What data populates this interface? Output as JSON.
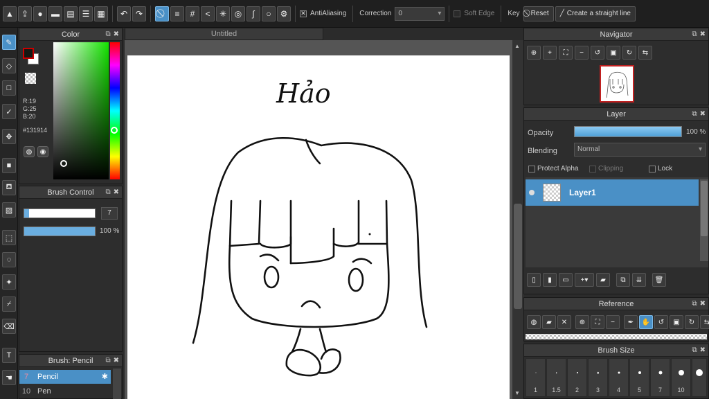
{
  "toolbar": {
    "antialiasing_label": "AntiAliasing",
    "correction_label": "Correction",
    "correction_value": "0",
    "soft_edge_label": "Soft Edge",
    "key_label": "Key",
    "reset_label": "Reset",
    "straight_line_label": "Create a straight line"
  },
  "color_panel": {
    "title": "Color",
    "r": "R:19",
    "g": "G:25",
    "b": "B:20",
    "hex": "#131914",
    "foreground_color": "#131914"
  },
  "brush_control": {
    "title": "Brush Control",
    "size_value": "7",
    "opacity_value": "100 %",
    "size_fraction": 0.07,
    "opacity_fraction": 1.0
  },
  "brush_list": {
    "title": "Brush: Pencil",
    "items": [
      {
        "num": "7",
        "label": "Pencil",
        "selected": true
      },
      {
        "num": "10",
        "label": "Pen",
        "selected": false
      }
    ]
  },
  "canvas": {
    "tab_title": "Untitled",
    "drawing_text": "Hảo"
  },
  "navigator": {
    "title": "Navigator"
  },
  "layer_panel": {
    "title": "Layer",
    "opacity_label": "Opacity",
    "opacity_value": "100 %",
    "blending_label": "Blending",
    "blending_value": "Normal",
    "protect_alpha_label": "Protect Alpha",
    "clipping_label": "Clipping",
    "lock_label": "Lock",
    "layer_name": "Layer1"
  },
  "reference_panel": {
    "title": "Reference"
  },
  "brush_size_panel": {
    "title": "Brush Size",
    "sizes": [
      "1",
      "1.5",
      "2",
      "3",
      "4",
      "5",
      "7",
      "10"
    ]
  },
  "colors": {
    "accent": "#4a90c6",
    "panel_bg": "#2d2d2d",
    "selection_red": "#c02020"
  }
}
